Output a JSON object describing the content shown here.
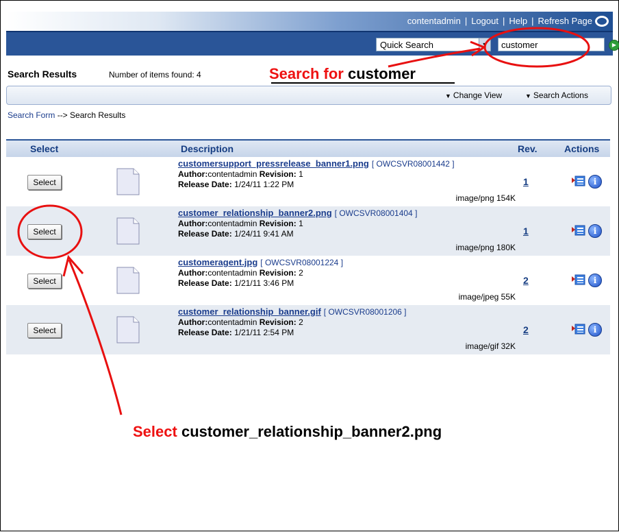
{
  "header": {
    "links": [
      "contentadmin",
      "Logout",
      "Help",
      "Refresh Page"
    ]
  },
  "search": {
    "mode": "Quick Search",
    "query": "customer"
  },
  "results": {
    "title": "Search Results",
    "count_text": "Number of items found: 4"
  },
  "toolbar": {
    "change_view": "Change View",
    "search_actions": "Search Actions"
  },
  "breadcrumb": {
    "form_link": "Search Form",
    "arrow": " --> ",
    "current": "Search Results"
  },
  "table": {
    "columns": [
      "Select",
      "Description",
      "Rev.",
      "Actions"
    ],
    "rows": [
      {
        "select": "Select",
        "name": "customersupport_pressrelease_banner1.png",
        "doc_id": "[ OWCSVR08001442 ]",
        "author_label": "Author:",
        "author": "contentadmin",
        "revision_label": "Revision:",
        "revision": "1",
        "release_label": "Release Date:",
        "release": "1/24/11 1:22 PM",
        "type_size": "image/png 154K",
        "rev": "1"
      },
      {
        "select": "Select",
        "name": "customer_relationship_banner2.png",
        "doc_id": "[ OWCSVR08001404 ]",
        "author_label": "Author:",
        "author": "contentadmin",
        "revision_label": "Revision:",
        "revision": "1",
        "release_label": "Release Date:",
        "release": "1/24/11 9:41 AM",
        "type_size": "image/png 180K",
        "rev": "1"
      },
      {
        "select": "Select",
        "name": "customeragent.jpg",
        "doc_id": "[ OWCSVR08001224 ]",
        "author_label": "Author:",
        "author": "contentadmin",
        "revision_label": "Revision:",
        "revision": "2",
        "release_label": "Release Date:",
        "release": "1/21/11 3:46 PM",
        "type_size": "image/jpeg 55K",
        "rev": "2"
      },
      {
        "select": "Select",
        "name": "customer_relationship_banner.gif",
        "doc_id": "[ OWCSVR08001206 ]",
        "author_label": "Author:",
        "author": "contentadmin",
        "revision_label": "Revision:",
        "revision": "2",
        "release_label": "Release Date:",
        "release": "1/21/11 2:54 PM",
        "type_size": "image/gif 32K",
        "rev": "2"
      }
    ]
  },
  "annotations": {
    "search_note_red": "Search for",
    "search_note_black": "customer",
    "select_note_red": "Select",
    "select_note_black": "customer_relationship_banner2.png"
  },
  "colors": {
    "header_blue": "#2a5598",
    "link_blue": "#1a3c8c",
    "annotation_red": "#ee1111",
    "row_alt": "#e6ebf2"
  }
}
